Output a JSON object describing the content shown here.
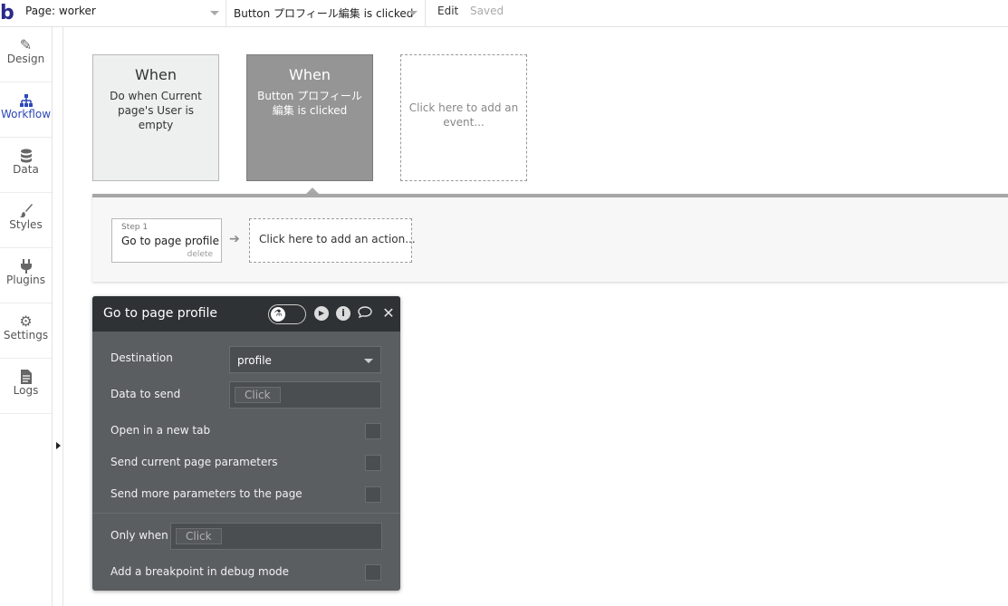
{
  "topbar": {
    "logo": "b",
    "page_label": "Page: worker",
    "event_label": "Button プロフィール編集 is clicked",
    "edit": "Edit",
    "saved": "Saved"
  },
  "sidebar": {
    "items": [
      {
        "label": "Design",
        "icon": "design-icon"
      },
      {
        "label": "Workflow",
        "icon": "workflow-icon"
      },
      {
        "label": "Data",
        "icon": "data-icon"
      },
      {
        "label": "Styles",
        "icon": "styles-icon"
      },
      {
        "label": "Plugins",
        "icon": "plugins-icon"
      },
      {
        "label": "Settings",
        "icon": "gear-icon"
      },
      {
        "label": "Logs",
        "icon": "logs-icon"
      }
    ],
    "active": "Workflow",
    "active_color": "#2d48b8"
  },
  "events": [
    {
      "when": "When",
      "description": "Do when Current page's User is empty"
    },
    {
      "when": "When",
      "description": "Button プロフィール編集 is clicked"
    },
    {
      "description": "Click here to add an event..."
    }
  ],
  "actions": {
    "step": {
      "number": "Step 1",
      "name": "Go to page profile",
      "delete": "delete"
    },
    "add_action": "Click here to add an action..."
  },
  "panel": {
    "title": "Go to page profile",
    "destination_label": "Destination",
    "destination_value": "profile",
    "data_to_send_label": "Data to send",
    "data_to_send_placeholder": "Click",
    "open_new_tab_label": "Open in a new tab",
    "send_current_params_label": "Send current page parameters",
    "send_more_params_label": "Send more parameters to the page",
    "only_when_label": "Only when",
    "only_when_placeholder": "Click",
    "breakpoint_label": "Add a breakpoint in debug mode"
  }
}
